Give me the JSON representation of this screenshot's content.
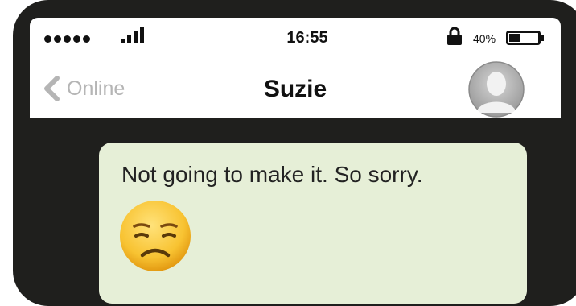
{
  "status_bar": {
    "time": "16:55",
    "battery_percent": "40%",
    "signal_dots": 5,
    "battery_level": 0.4
  },
  "nav": {
    "back_label": "Online",
    "title": "Suzie",
    "avatar_icon": "person-silhouette-icon"
  },
  "messages": [
    {
      "text": "Not going to make it. So sorry.",
      "emoji": "disappointed-face-emoji"
    }
  ],
  "colors": {
    "phone_frame": "#1f1f1d",
    "bubble": "#e6efd7",
    "back_gray": "#b5b5b5"
  }
}
